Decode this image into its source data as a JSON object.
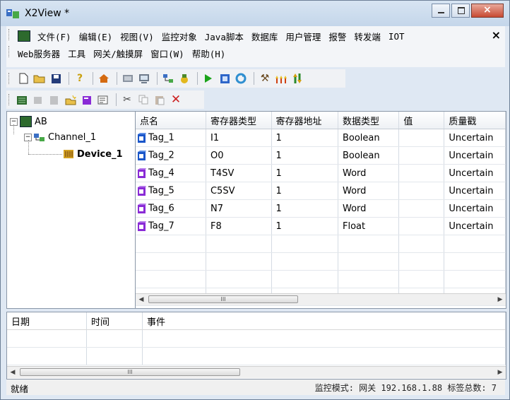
{
  "window": {
    "title": "X2View *"
  },
  "menu": {
    "row1": [
      "文件(F)",
      "编辑(E)",
      "视图(V)",
      "监控对象",
      "Java脚本",
      "数据库",
      "用户管理",
      "报警",
      "转发端",
      "IOT"
    ],
    "row2": [
      "Web服务器",
      "工具",
      "网关/触摸屏",
      "窗口(W)",
      "帮助(H)"
    ],
    "mdi_close": "×"
  },
  "toolbar1": [
    "new-icon",
    "open-icon",
    "save-icon",
    "help-icon",
    "home-icon",
    "device-icon",
    "monitor-icon",
    "network-icon",
    "plugin-icon",
    "run-icon",
    "stop-icon",
    "refresh-icon",
    "tools-icon",
    "load-icon",
    "transfer-icon"
  ],
  "toolbar2": [
    "add-channel-icon",
    "add-device-icon",
    "add-tag-icon",
    "new-tag-icon",
    "import-icon",
    "properties-icon",
    "cut-icon",
    "copy-icon",
    "paste-icon",
    "delete-icon"
  ],
  "tree": {
    "root": "AB",
    "channel": "Channel_1",
    "device": "Device_1"
  },
  "grid": {
    "columns": [
      "点名",
      "寄存器类型",
      "寄存器地址",
      "数据类型",
      "值",
      "质量戳"
    ],
    "rows": [
      {
        "name": "Tag_1",
        "reg_type": "I1",
        "reg_addr": "1",
        "data_type": "Boolean",
        "value": "",
        "quality": "Uncertain",
        "icon": "boolean-tag-icon"
      },
      {
        "name": "Tag_2",
        "reg_type": "O0",
        "reg_addr": "1",
        "data_type": "Boolean",
        "value": "",
        "quality": "Uncertain",
        "icon": "boolean-tag-icon"
      },
      {
        "name": "Tag_4",
        "reg_type": "T4SV",
        "reg_addr": "1",
        "data_type": "Word",
        "value": "",
        "quality": "Uncertain",
        "icon": "analog-tag-icon"
      },
      {
        "name": "Tag_5",
        "reg_type": "C5SV",
        "reg_addr": "1",
        "data_type": "Word",
        "value": "",
        "quality": "Uncertain",
        "icon": "analog-tag-icon"
      },
      {
        "name": "Tag_6",
        "reg_type": "N7",
        "reg_addr": "1",
        "data_type": "Word",
        "value": "",
        "quality": "Uncertain",
        "icon": "analog-tag-icon"
      },
      {
        "name": "Tag_7",
        "reg_type": "F8",
        "reg_addr": "1",
        "data_type": "Float",
        "value": "",
        "quality": "Uncertain",
        "icon": "analog-tag-icon"
      }
    ],
    "empty_rows": 4,
    "scroll_thumb": "III"
  },
  "log": {
    "columns": [
      "日期",
      "时间",
      "事件"
    ],
    "scroll_thumb": "III"
  },
  "status": {
    "left": "就绪",
    "right": "监控模式: 网关 192.168.1.88 标签总数: 7"
  },
  "colors": {
    "boolean_tag": "#1a56c9",
    "analog_tag": "#8a2bd6",
    "run": "#1aa31a",
    "stop": "#2e66c9",
    "delete": "#cc2020"
  }
}
